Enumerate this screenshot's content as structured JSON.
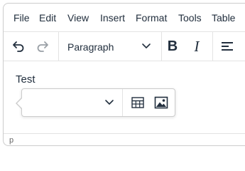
{
  "menubar": {
    "items": [
      {
        "label": "File"
      },
      {
        "label": "Edit"
      },
      {
        "label": "View"
      },
      {
        "label": "Insert"
      },
      {
        "label": "Format"
      },
      {
        "label": "Tools"
      },
      {
        "label": "Table"
      }
    ]
  },
  "toolbar": {
    "undo_icon": "undo-icon",
    "redo_icon": "redo-icon",
    "redo_disabled": true,
    "block_format": "Paragraph",
    "bold_icon": "bold-icon",
    "italic_icon": "italic-icon",
    "align_icon": "align-left-icon"
  },
  "content": {
    "paragraph": "Test"
  },
  "quickbar": {
    "format_value": "",
    "table_icon": "table-icon",
    "image_icon": "image-icon"
  },
  "statusbar": {
    "path": "p"
  },
  "colors": {
    "text": "#222f3e",
    "border": "#cccccc",
    "disabled": "#9aa0a6"
  }
}
